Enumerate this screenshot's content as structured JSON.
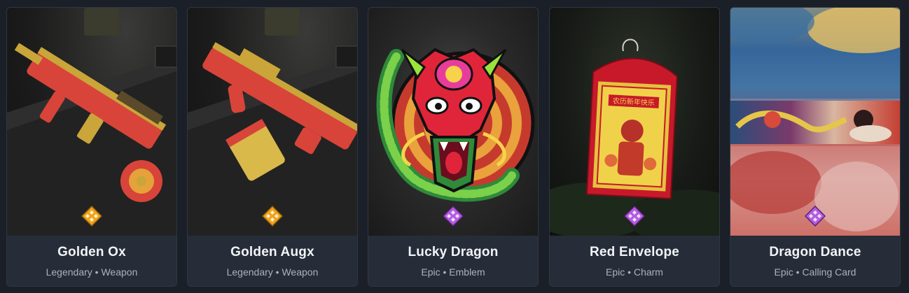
{
  "items": [
    {
      "name": "Golden Ox",
      "rarity": "Legendary",
      "type": "Weapon",
      "rarity_color": "#f0a21e",
      "icon": "legendary-rarity-icon"
    },
    {
      "name": "Golden Augx",
      "rarity": "Legendary",
      "type": "Weapon",
      "rarity_color": "#f0a21e",
      "icon": "legendary-rarity-icon"
    },
    {
      "name": "Lucky Dragon",
      "rarity": "Epic",
      "type": "Emblem",
      "rarity_color": "#b35de0",
      "icon": "epic-rarity-icon"
    },
    {
      "name": "Red Envelope",
      "rarity": "Epic",
      "type": "Charm",
      "rarity_color": "#b35de0",
      "icon": "epic-rarity-icon"
    },
    {
      "name": "Dragon Dance",
      "rarity": "Epic",
      "type": "Calling Card",
      "rarity_color": "#b35de0",
      "icon": "epic-rarity-icon"
    }
  ],
  "separator": "•",
  "art_texts": {
    "envelope_banner": "农历新年快乐"
  }
}
